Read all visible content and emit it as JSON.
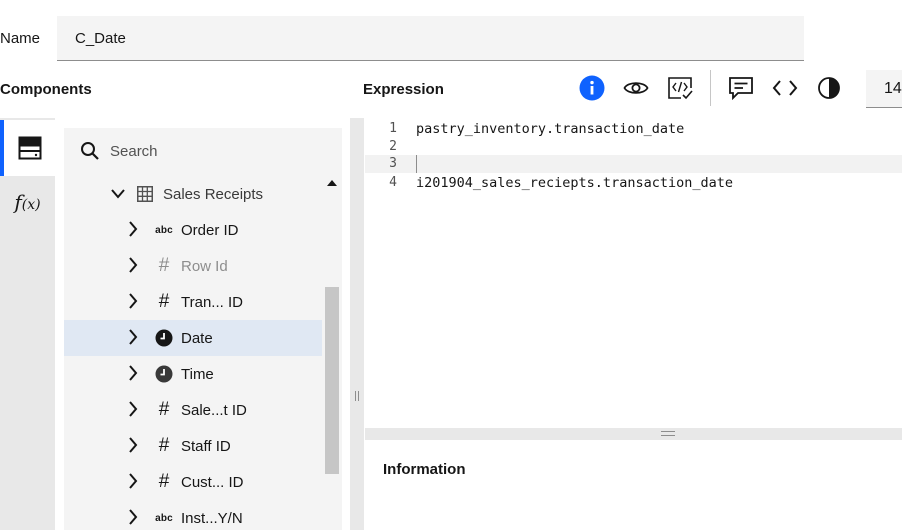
{
  "name_field": {
    "label": "Name",
    "value": "C_Date"
  },
  "components": {
    "title": "Components"
  },
  "expression": {
    "title": "Expression"
  },
  "toolbar": {
    "buttons": [
      "info-icon",
      "eye-icon",
      "validate-code-icon",
      "comment-icon",
      "code-brackets-icon",
      "contrast-icon"
    ],
    "zoom_value": "14",
    "accent_color": "#0f62fe"
  },
  "rail": {
    "fx_label": "f",
    "fx_sub": "(x)"
  },
  "search": {
    "placeholder": "Search"
  },
  "tree": {
    "table_name": "Sales Receipts",
    "items": [
      {
        "label": "Order ID",
        "type": "abc",
        "icon": "text-type-icon"
      },
      {
        "label": "Row Id",
        "type": "#",
        "icon": "number-type-icon"
      },
      {
        "label": "Tran... ID",
        "type": "#",
        "icon": "number-type-icon"
      },
      {
        "label": "Date",
        "type": "clock",
        "icon": "clock-icon"
      },
      {
        "label": "Time",
        "type": "clock",
        "icon": "clock-icon"
      },
      {
        "label": "Sale...t ID",
        "type": "#",
        "icon": "number-type-icon"
      },
      {
        "label": "Staff ID",
        "type": "#",
        "icon": "number-type-icon"
      },
      {
        "label": "Cust... ID",
        "type": "#",
        "icon": "number-type-icon"
      },
      {
        "label": "Inst...Y/N",
        "type": "abc",
        "icon": "text-type-icon"
      }
    ]
  },
  "editor": {
    "lines": [
      {
        "num": "1",
        "text": "pastry_inventory.transaction_date"
      },
      {
        "num": "2",
        "text": ""
      },
      {
        "num": "3",
        "text": ""
      },
      {
        "num": "4",
        "text": "i201904_sales_reciepts.transaction_date"
      }
    ]
  },
  "info": {
    "title": "Information"
  }
}
